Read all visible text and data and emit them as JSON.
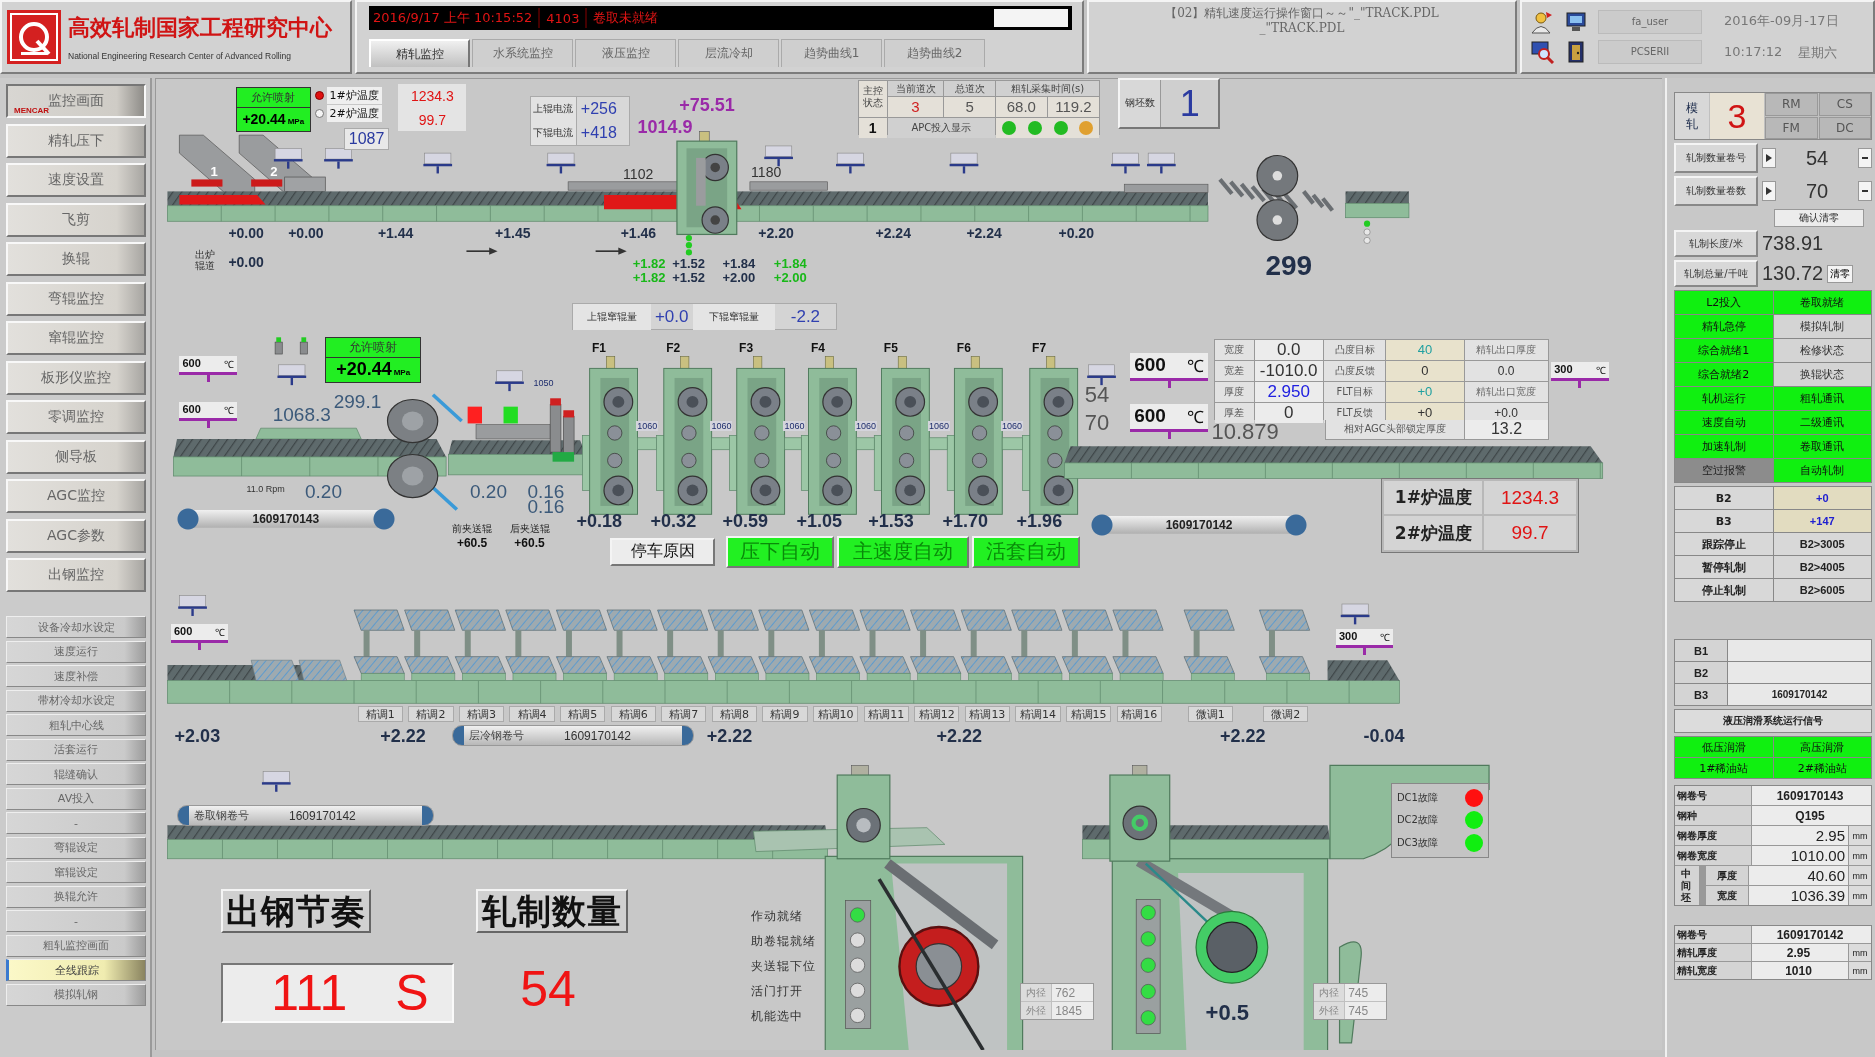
{
  "header": {
    "logo": {
      "title": "高效轧制国家工程研究中心",
      "subtitle": "National Engineering Research Center of Advanced Rolling"
    },
    "alarm": {
      "time": "2016/9/17 上午 10:15:52",
      "code": "4103",
      "message": "卷取未就绪"
    },
    "tabs": [
      {
        "label": "精轧监控",
        "selected": true
      },
      {
        "label": "水系统监控",
        "selected": false
      },
      {
        "label": "液压监控",
        "selected": false
      },
      {
        "label": "层流冷却",
        "selected": false
      },
      {
        "label": "趋势曲线1",
        "selected": false
      },
      {
        "label": "趋势曲线2",
        "selected": false
      }
    ],
    "window_title": [
      "【02】精轧速度运行操作窗口～～\"_\"TRACK.PDL",
      "_\"TRACK.PDL"
    ],
    "user": "fa_user",
    "station": "PCSERII",
    "date": "2016年-09月-17日",
    "time": "10:17:12",
    "weekday": "星期六"
  },
  "sidebar": {
    "main_items": [
      {
        "label": "监控画面",
        "badge": "MENCAR",
        "selected": true
      },
      {
        "label": "精轧压下",
        "selected": false
      },
      {
        "label": "速度设置",
        "selected": false
      },
      {
        "label": "飞剪",
        "selected": false
      },
      {
        "label": "换辊",
        "selected": false
      },
      {
        "label": "弯辊监控",
        "selected": false
      },
      {
        "label": "窜辊监控",
        "selected": false
      },
      {
        "label": "板形仪监控",
        "selected": false
      },
      {
        "label": "零调监控",
        "selected": false
      },
      {
        "label": "侧导板",
        "selected": false
      },
      {
        "label": "AGC监控",
        "selected": false
      },
      {
        "label": "AGC参数",
        "selected": false
      },
      {
        "label": "出钢监控",
        "selected": false
      }
    ],
    "sub_items": [
      {
        "label": "设备冷却水设定",
        "selected": false
      },
      {
        "label": "速度运行",
        "selected": false
      },
      {
        "label": "速度补偿",
        "selected": false
      },
      {
        "label": "带材冷却水设定",
        "selected": false
      },
      {
        "label": "粗轧中心线",
        "selected": false
      },
      {
        "label": "活套运行",
        "selected": false
      },
      {
        "label": "辊缝确认",
        "selected": false
      },
      {
        "label": "AV投入",
        "selected": false
      },
      {
        "label": "-",
        "selected": false
      },
      {
        "label": "弯辊设定",
        "selected": false
      },
      {
        "label": "窜辊设定",
        "selected": false
      },
      {
        "label": "换辊允许",
        "selected": false
      },
      {
        "label": "-",
        "selected": false
      },
      {
        "label": "粗轧监控画面",
        "selected": false
      },
      {
        "label": "全线跟踪",
        "selected": true
      },
      {
        "label": "模拟轧钢",
        "selected": false
      }
    ]
  },
  "roughing": {
    "descaler": {
      "label": "允许喷射",
      "pressure": "+20.44",
      "unit": "MPa"
    },
    "furnaces": [
      {
        "label": "1#炉温度",
        "value": "1234.3",
        "lamp_on": true
      },
      {
        "label": "2#炉温度",
        "value": "99.7",
        "lamp_on": false
      }
    ],
    "discharge_temp": "1087",
    "slabs": [
      "1",
      "2"
    ],
    "currents": [
      {
        "label": "上辊电流",
        "value": "+256"
      },
      {
        "label": "下辊电流",
        "value": "+418"
      }
    ],
    "stand_load": "+75.51",
    "stand_temp": "1014.9",
    "entry_temp": "1102",
    "exit_temp": "1180",
    "speeds": [
      "+0.00",
      "+0.00",
      "+1.44",
      "+1.45",
      "+1.46",
      "+2.20",
      "+2.24",
      "+2.24",
      "+0.20"
    ],
    "discharge_speed": {
      "label": "出炉辊道",
      "value": "+0.00"
    },
    "gap_rows": [
      [
        "+1.82",
        "+1.52",
        "+1.84",
        "+1.84"
      ],
      [
        "+1.82",
        "+1.52",
        "+2.00",
        "+2.00"
      ]
    ],
    "pass_table": {
      "corner": "主控状态",
      "headers": [
        "当前道次",
        "总道次",
        "粗轧采集时间(s)"
      ],
      "values": [
        "3",
        "5",
        "68.0",
        "119.2"
      ],
      "pass": "1",
      "apc_label": "APC投入显示",
      "lamps": [
        {
          "color": "#22bb22"
        },
        {
          "color": "#22bb22"
        },
        {
          "color": "#22bb22"
        },
        {
          "color": "#e0a030"
        }
      ]
    },
    "billet_count": {
      "label": "钢坯数",
      "value": "1"
    },
    "pinch_roll_value": "299"
  },
  "finishing": {
    "shift": [
      {
        "label": "上辊窜辊量",
        "value": "+0.0"
      },
      {
        "label": "下辊窜辊量",
        "value": "-2.2"
      }
    ],
    "entry_temps": [
      {
        "value": "600",
        "unit": "℃"
      },
      {
        "value": "600",
        "unit": "℃"
      }
    ],
    "descaler": {
      "label": "允许喷射",
      "pressure": "+20.44",
      "unit": "MPa"
    },
    "bar_temp": "1068.3",
    "shear_temp": "299.1",
    "shear_lamps": [
      {
        "color": "#ff2020"
      },
      {
        "color": "#22dd22"
      }
    ],
    "shear_speed": {
      "label": "11.0 Rpm",
      "value": "0.20"
    },
    "shear_values": [
      "0.20",
      "0.16",
      "0.16"
    ],
    "pinch_rolls": [
      {
        "label": "前夹送辊",
        "value": "+60.5"
      },
      {
        "label": "后夹送辊",
        "value": "+60.5"
      }
    ],
    "entry_coil": "1609170143",
    "entry_looper": "1050",
    "stands": [
      {
        "name": "F1",
        "speed": "+0.18"
      },
      {
        "name": "F2",
        "speed": "+0.32"
      },
      {
        "name": "F3",
        "speed": "+0.59"
      },
      {
        "name": "F4",
        "speed": "+1.05"
      },
      {
        "name": "F5",
        "speed": "+1.53"
      },
      {
        "name": "F6",
        "speed": "+1.70"
      },
      {
        "name": "F7",
        "speed": "+1.96"
      }
    ],
    "loopers": [
      "1060",
      "1060",
      "1060",
      "1060",
      "1060",
      "1060"
    ],
    "buttons": [
      {
        "label": "停车原因",
        "on": false
      },
      {
        "label": "压下自动",
        "on": true
      },
      {
        "label": "主速度自动",
        "on": true
      },
      {
        "label": "活套自动",
        "on": true
      }
    ],
    "exit_temps": [
      {
        "value": "600",
        "unit": "℃"
      },
      {
        "value": "600",
        "unit": "℃"
      }
    ],
    "targets": [
      "54",
      "70"
    ],
    "exit_thickness": "10.879",
    "gauge_table": {
      "rows": [
        [
          "宽度",
          "0.0",
          "凸度目标",
          "40",
          "精轧出口厚度"
        ],
        [
          "宽差",
          "-1010.0",
          "凸度反馈",
          "0",
          "0.0"
        ],
        [
          "厚度",
          "2.950",
          "FLT目标",
          "+0",
          "精轧出口宽度"
        ],
        [
          "厚差",
          "0",
          "FLT反馈",
          "+0",
          "+0.0"
        ]
      ],
      "lock": {
        "label": "相对AGC头部锁定厚度",
        "value": "13.2"
      }
    },
    "exit_pyrometer": {
      "value": "300",
      "unit": "℃"
    },
    "furnace_temps": [
      {
        "label": "1#炉温度",
        "value": "1234.3"
      },
      {
        "label": "2#炉温度",
        "value": "99.7"
      }
    ],
    "exit_coil": "1609170142"
  },
  "laminar_cooling": {
    "entry_temp": {
      "value": "600",
      "unit": "℃"
    },
    "exit_temp": {
      "value": "300",
      "unit": "℃"
    },
    "sections": [
      "精调1",
      "精调2",
      "精调3",
      "精调4",
      "精调5",
      "精调6",
      "精调7",
      "精调8",
      "精调9",
      "精调10",
      "精调11",
      "精调12",
      "精调13",
      "精调14",
      "精调15",
      "精调16",
      "微调1",
      "微调2"
    ],
    "speeds": [
      "+2.03",
      "+2.22",
      "+2.22",
      "+2.22",
      "+2.22",
      "-0.04"
    ],
    "coil": {
      "label": "层冷钢卷号",
      "value": "1609170142"
    }
  },
  "coiling": {
    "coil": {
      "label": "卷取钢卷号",
      "value": "1609170142"
    },
    "signals": [
      "作动就绪",
      "助卷辊就绪",
      "夹送辊下位",
      "活门打开",
      "机能选中"
    ],
    "coilers": [
      {
        "lamps": [
          {
            "on": true
          },
          {
            "on": false
          },
          {
            "on": false
          },
          {
            "on": false
          },
          {
            "on": false
          }
        ],
        "diameters": [
          {
            "label": "内径",
            "value": "762"
          },
          {
            "label": "外径",
            "value": "1845"
          }
        ]
      },
      {
        "lamps": [
          {
            "on": true
          },
          {
            "on": true
          },
          {
            "on": true
          },
          {
            "on": true
          },
          {
            "on": true
          }
        ],
        "diameters": [
          {
            "label": "内径",
            "value": "745"
          },
          {
            "label": "外径",
            "value": "745"
          }
        ],
        "reading": "+0.5"
      }
    ],
    "faults": [
      {
        "label": "DC1故障",
        "color": "#ff1010"
      },
      {
        "label": "DC2故障",
        "color": "#10ee10"
      },
      {
        "label": "DC3故障",
        "color": "#10ee10"
      }
    ],
    "pace": {
      "label": "出钢节奏",
      "value": "111",
      "unit": "S"
    },
    "count": {
      "label": "轧制数量",
      "value": "54"
    }
  },
  "status_panel": {
    "mode": {
      "label": "模轧",
      "value": "3",
      "areas": [
        "RM",
        "CS",
        "FM",
        "DC"
      ]
    },
    "counters": [
      {
        "label": "轧制数量卷号",
        "value": "54"
      },
      {
        "label": "轧制数量卷数",
        "value": "70"
      }
    ],
    "reset_button": "确认清零",
    "totals": [
      {
        "label": "轧制长度/米",
        "value": "738.91"
      },
      {
        "label": "轧制总量/千吨",
        "value": "130.72",
        "button": "清零"
      }
    ],
    "signals": [
      {
        "label": "L2投入",
        "on": true
      },
      {
        "label": "卷取就绪",
        "on": true
      },
      {
        "label": "精轧急停",
        "on": true
      },
      {
        "label": "模拟轧制",
        "on": false
      },
      {
        "label": "综合就绪1",
        "on": true
      },
      {
        "label": "检修状态",
        "on": false
      },
      {
        "label": "综合就绪2",
        "on": true
      },
      {
        "label": "换辊状态",
        "on": false
      },
      {
        "label": "轧机运行",
        "on": true
      },
      {
        "label": "粗轧通讯",
        "on": true
      },
      {
        "label": "速度自动",
        "on": true
      },
      {
        "label": "二级通讯",
        "on": true
      },
      {
        "label": "加速轧制",
        "on": true
      },
      {
        "label": "卷取通讯",
        "on": true
      },
      {
        "label": "空过报警",
        "on": false
      },
      {
        "label": "自动轧制",
        "on": true
      }
    ],
    "thresholds": [
      {
        "label": "B2",
        "value": "+0",
        "kind": "reading"
      },
      {
        "label": "B3",
        "value": "+147",
        "kind": "reading"
      },
      {
        "label": "跟踪停止",
        "value": "B2>3005",
        "kind": "limit"
      },
      {
        "label": "暂停轧制",
        "value": "B2>4005",
        "kind": "limit"
      },
      {
        "label": "停止轧制",
        "value": "B2>6005",
        "kind": "limit"
      }
    ],
    "tracking": [
      {
        "label": "B1"
      },
      {
        "label": "B2"
      },
      {
        "label": "B3",
        "value": "1609170142"
      }
    ],
    "hydraulics": {
      "title": "液压润滑系统运行信号",
      "signals": [
        {
          "label": "低压润滑",
          "on": true
        },
        {
          "label": "高压润滑",
          "on": true
        },
        {
          "label": "1#稀油站",
          "on": true
        },
        {
          "label": "2#稀油站",
          "on": true
        }
      ]
    },
    "current_coil": {
      "rows": [
        {
          "label": "钢卷号",
          "value": "1609170143"
        },
        {
          "label": "钢种",
          "value": "Q195"
        },
        {
          "label": "钢卷厚度",
          "value": "2.95",
          "unit": "mm"
        },
        {
          "label": "钢卷宽度",
          "value": "1010.00",
          "unit": "mm"
        }
      ],
      "intermediate": {
        "label": "中间坯",
        "rows": [
          {
            "label": "厚度",
            "value": "40.60",
            "unit": "mm"
          },
          {
            "label": "宽度",
            "value": "1036.39",
            "unit": "mm"
          }
        ]
      }
    },
    "previous_coil": [
      {
        "label": "钢卷号",
        "value": "1609170142"
      },
      {
        "label": "精轧厚度",
        "value": "2.95",
        "unit": "mm"
      },
      {
        "label": "精轧宽度",
        "value": "1010",
        "unit": "mm"
      }
    ]
  }
}
